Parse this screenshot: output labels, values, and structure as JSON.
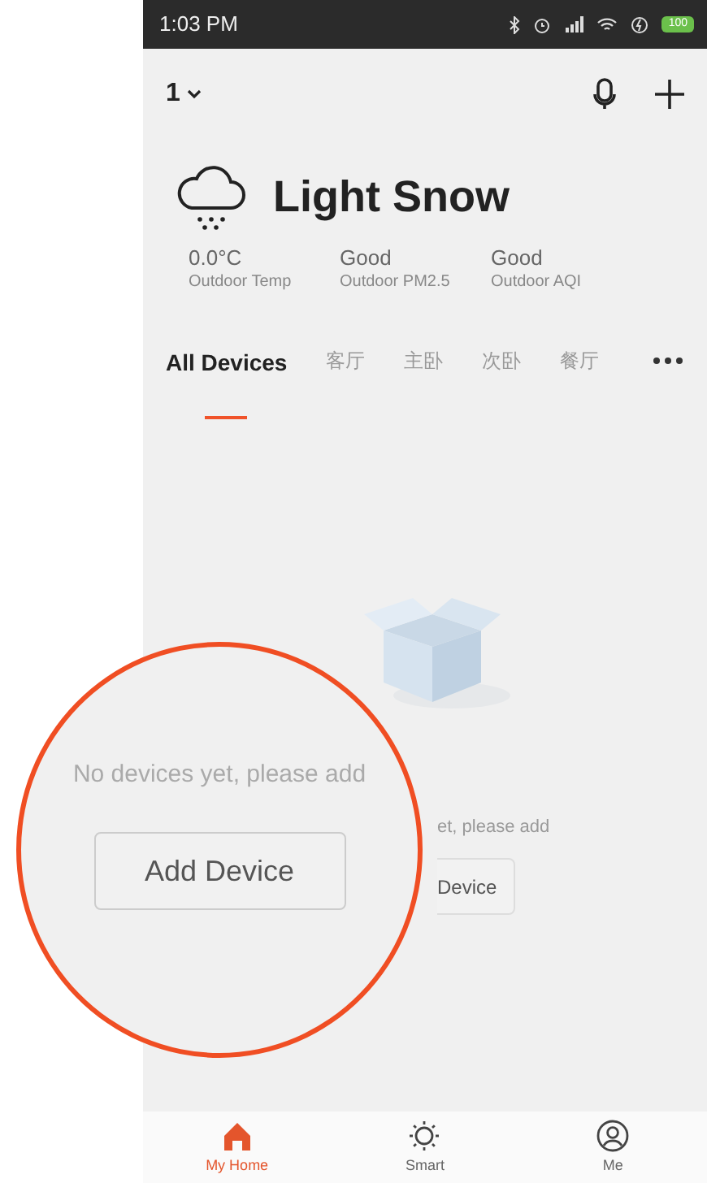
{
  "status_bar": {
    "time": "1:03 PM",
    "battery": "100"
  },
  "header": {
    "home": "1"
  },
  "weather": {
    "condition": "Light Snow",
    "stats": [
      {
        "value": "0.0°C",
        "label": "Outdoor Temp"
      },
      {
        "value": "Good",
        "label": "Outdoor PM2.5"
      },
      {
        "value": "Good",
        "label": "Outdoor AQI"
      }
    ]
  },
  "tabs": [
    {
      "label": "All Devices",
      "selected": true
    },
    {
      "label": "客厅",
      "selected": false
    },
    {
      "label": "主卧",
      "selected": false
    },
    {
      "label": "次卧",
      "selected": false
    },
    {
      "label": "餐厅",
      "selected": false
    }
  ],
  "empty_state": {
    "message_visible": "et, please add",
    "button_visible": "Device"
  },
  "magnifier": {
    "message": "No devices yet, please add",
    "button": "Add Device"
  },
  "bottom_nav": [
    {
      "label": "My Home",
      "selected": true
    },
    {
      "label": "Smart",
      "selected": false
    },
    {
      "label": "Me",
      "selected": false
    }
  ]
}
